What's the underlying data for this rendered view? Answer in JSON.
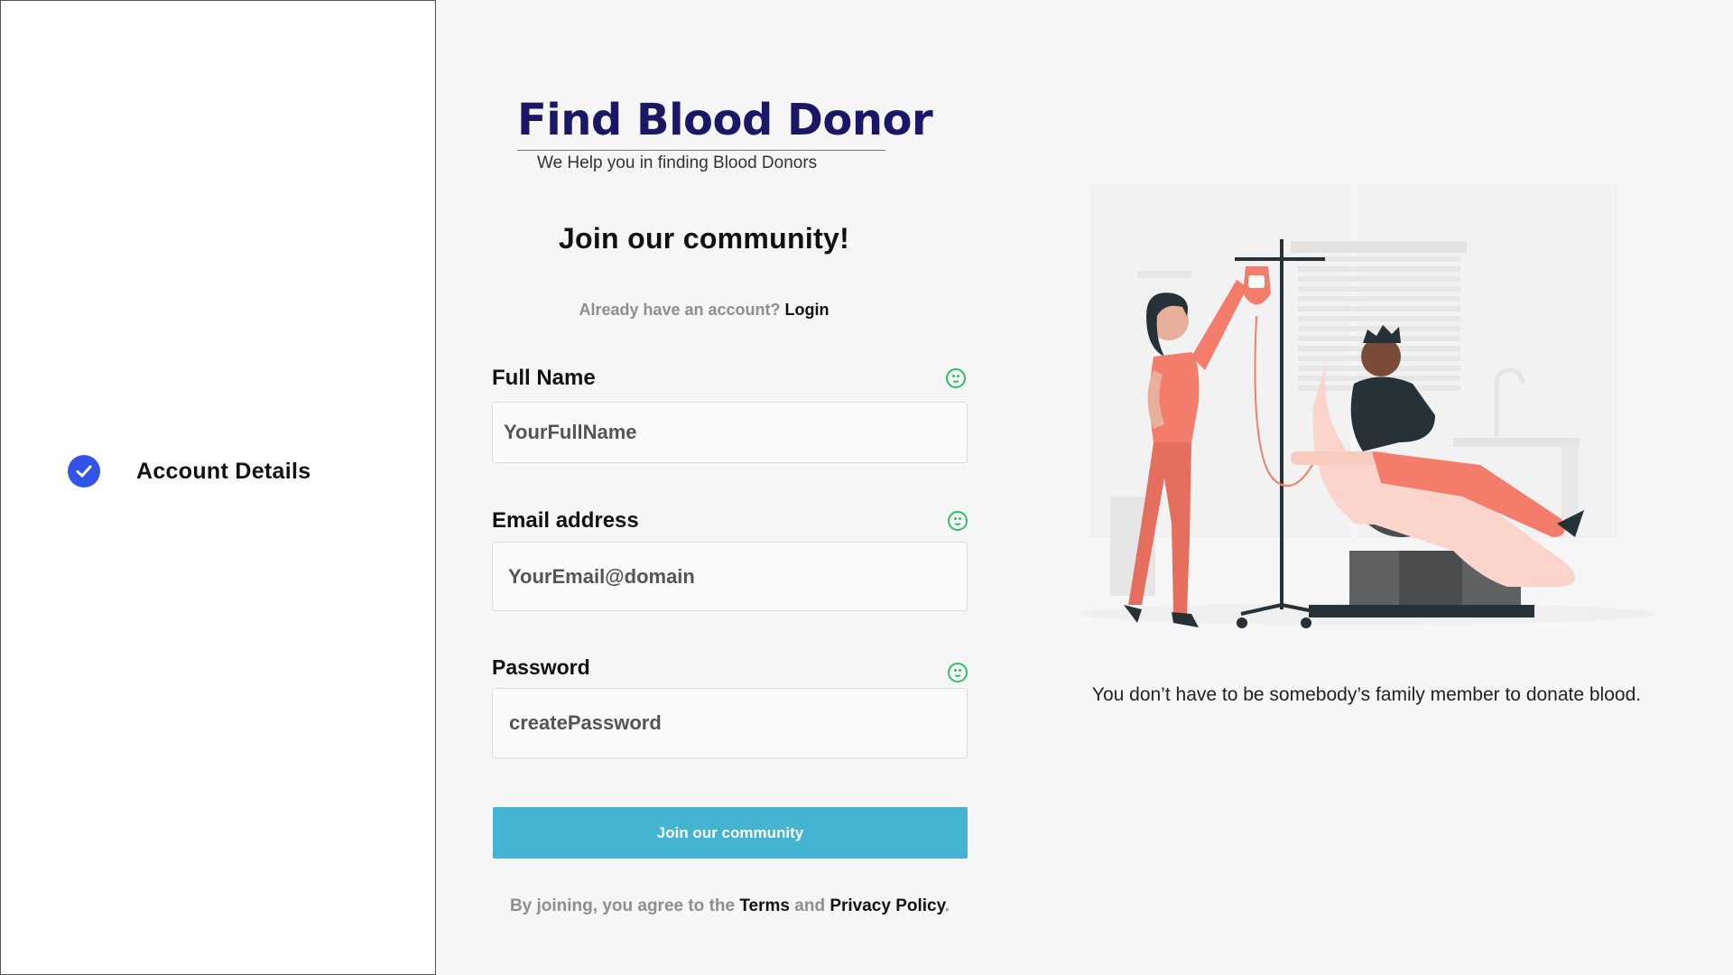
{
  "sidebar": {
    "steps": [
      {
        "label": "Account Details",
        "status": "completed",
        "icon": "check-circle-icon"
      }
    ],
    "colors": {
      "check": "#3253e8"
    }
  },
  "brand": {
    "title": "Find Blood Donor",
    "tagline": "We Help you in finding Blood Donors",
    "color": "#1a1766"
  },
  "form": {
    "heading": "Join our community!",
    "login_prompt": "Already have an account?",
    "login_link": "Login",
    "fields": {
      "full_name": {
        "label": "Full Name",
        "placeholder": "YourFullName",
        "value": "",
        "status_icon": "smiley-icon"
      },
      "email": {
        "label": "Email address",
        "placeholder": "YourEmail@domain",
        "value": "",
        "status_icon": "smiley-icon"
      },
      "password": {
        "label": "Password",
        "placeholder": "createPassword",
        "value": "",
        "status_icon": "smiley-icon"
      }
    },
    "submit_label": "Join our community",
    "submit_color": "#44b4d2",
    "valid_color": "#2fbf66",
    "terms": {
      "prefix": "By joining, you agree to the",
      "terms_link": "Terms",
      "and": "and",
      "privacy_link": "Privacy Policy",
      "suffix": "."
    }
  },
  "illustration": {
    "icon": "blood-donation-illustration",
    "caption": "You don’t have to be somebody’s family member to donate blood."
  }
}
